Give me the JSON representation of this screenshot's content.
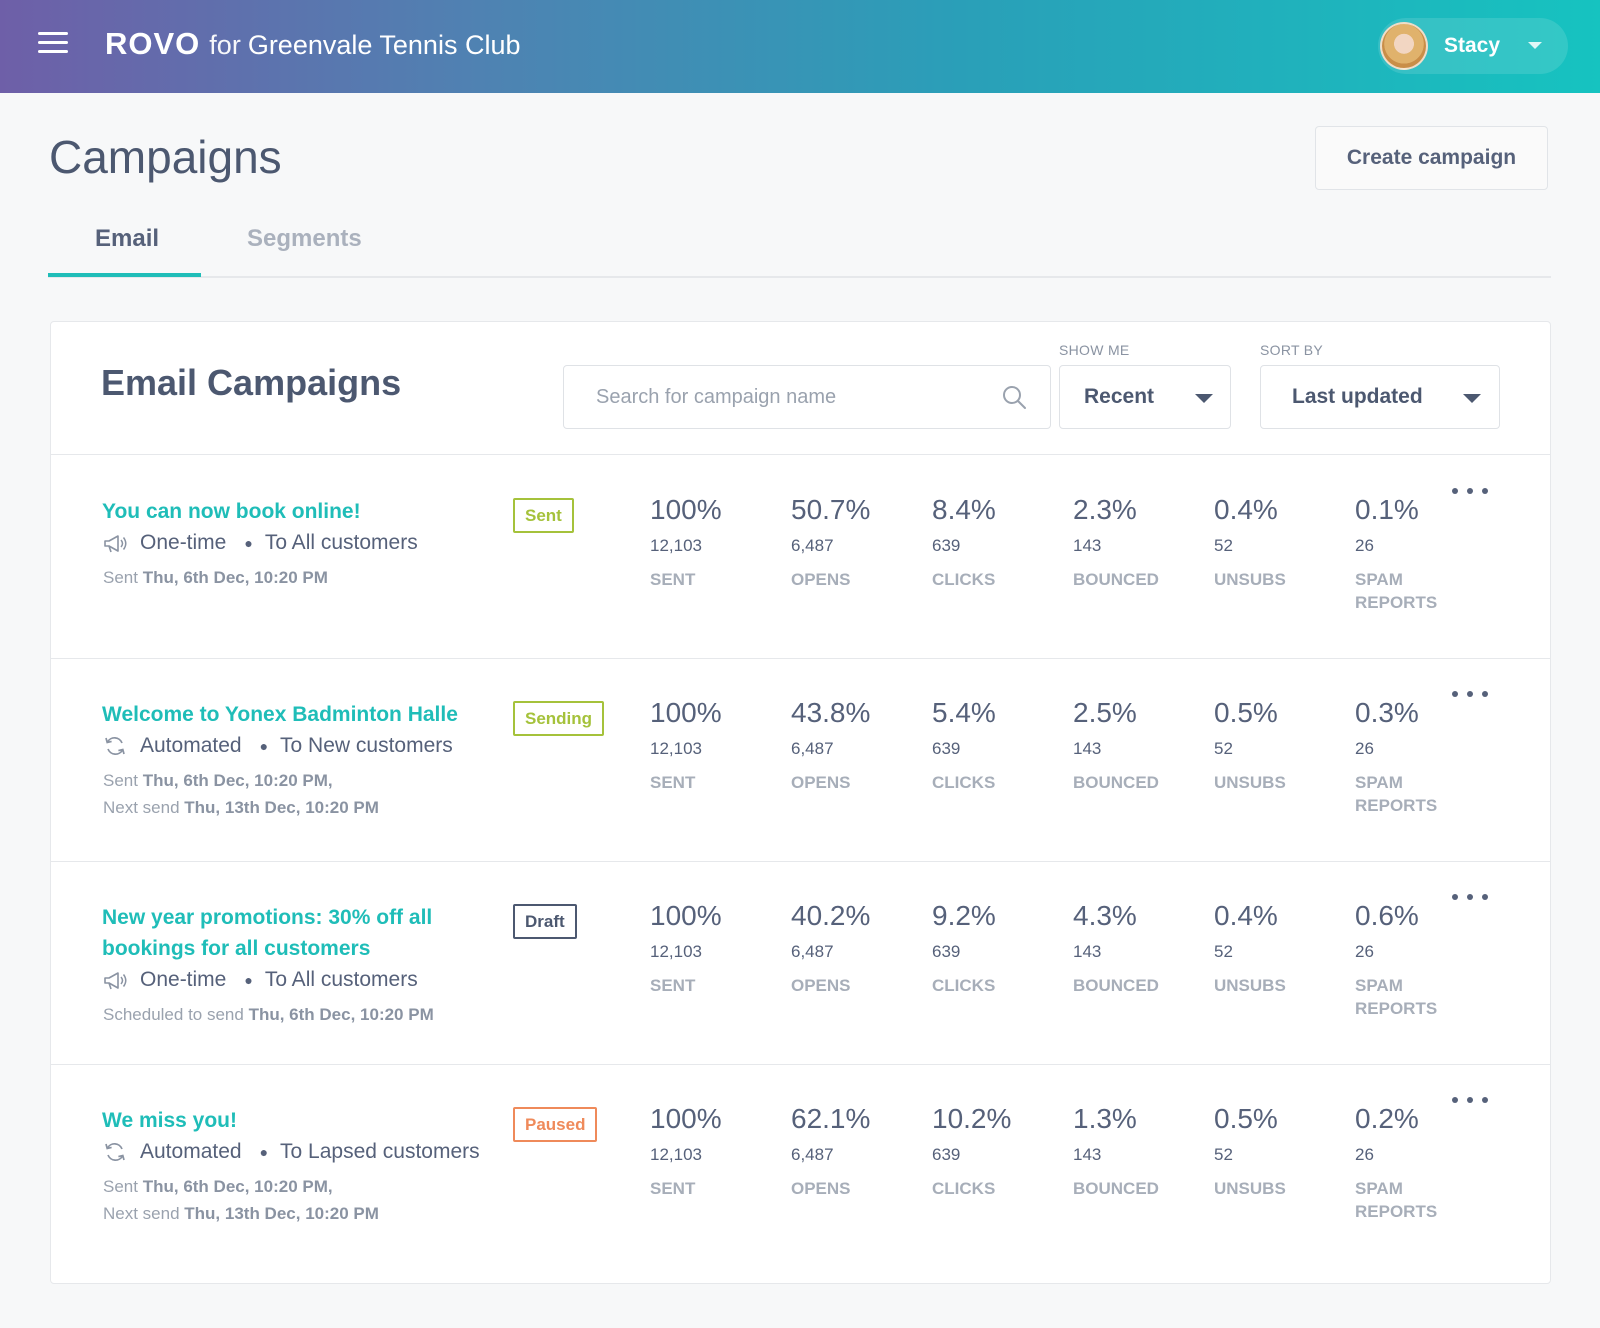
{
  "header": {
    "logo_word": "ROVO",
    "logo_for": "for",
    "club_name": "Greenvale Tennis Club",
    "user_name": "Stacy"
  },
  "page": {
    "title": "Campaigns",
    "create_label": "Create campaign"
  },
  "tabs": [
    {
      "label": "Email",
      "active": true
    },
    {
      "label": "Segments",
      "active": false
    }
  ],
  "card": {
    "title": "Email Campaigns",
    "search_placeholder": "Search for campaign name",
    "show_me_label": "SHOW ME",
    "show_me_value": "Recent",
    "sort_by_label": "SORT BY",
    "sort_by_value": "Last updated"
  },
  "stat_labels": [
    "SENT",
    "OPENS",
    "CLICKS",
    "BOUNCED",
    "UNSUBS",
    "SPAM REPORTS"
  ],
  "campaigns": [
    {
      "name": "You can now book online!",
      "status": "Sent",
      "status_color": "#a5c23b",
      "type": "One-time",
      "type_icon": "megaphone-icon",
      "audience": "To All customers",
      "date_prefix": "Sent",
      "date": "Thu, 6th Dec, 10:20 PM",
      "next_prefix": "",
      "next_date": "",
      "stats": [
        {
          "pct": "100%",
          "num": "12,103"
        },
        {
          "pct": "50.7%",
          "num": "6,487"
        },
        {
          "pct": "8.4%",
          "num": "639"
        },
        {
          "pct": "2.3%",
          "num": "143"
        },
        {
          "pct": "0.4%",
          "num": "52"
        },
        {
          "pct": "0.1%",
          "num": "26"
        }
      ]
    },
    {
      "name": "Welcome to Yonex Badminton Halle",
      "status": "Sending",
      "status_color": "#a5c23b",
      "type": "Automated",
      "type_icon": "refresh-icon",
      "audience": "To New customers",
      "date_prefix": "Sent",
      "date": "Thu, 6th Dec, 10:20 PM,",
      "next_prefix": "Next send",
      "next_date": "Thu, 13th Dec, 10:20 PM",
      "stats": [
        {
          "pct": "100%",
          "num": "12,103"
        },
        {
          "pct": "43.8%",
          "num": "6,487"
        },
        {
          "pct": "5.4%",
          "num": "639"
        },
        {
          "pct": "2.5%",
          "num": "143"
        },
        {
          "pct": "0.5%",
          "num": "52"
        },
        {
          "pct": "0.3%",
          "num": "26"
        }
      ]
    },
    {
      "name": "New year promotions: 30% off all bookings for all customers",
      "status": "Draft",
      "status_color": "#4c5870",
      "type": "One-time",
      "type_icon": "megaphone-icon",
      "audience": "To All customers",
      "date_prefix": "Scheduled to send",
      "date": "Thu, 6th Dec, 10:20 PM",
      "next_prefix": "",
      "next_date": "",
      "stats": [
        {
          "pct": "100%",
          "num": "12,103"
        },
        {
          "pct": "40.2%",
          "num": "6,487"
        },
        {
          "pct": "9.2%",
          "num": "639"
        },
        {
          "pct": "4.3%",
          "num": "143"
        },
        {
          "pct": "0.4%",
          "num": "52"
        },
        {
          "pct": "0.6%",
          "num": "26"
        }
      ]
    },
    {
      "name": "We miss you!",
      "status": "Paused",
      "status_color": "#ef8a5a",
      "type": "Automated",
      "type_icon": "refresh-icon",
      "audience": "To Lapsed customers",
      "date_prefix": "Sent",
      "date": "Thu, 6th Dec, 10:20 PM,",
      "next_prefix": "Next send",
      "next_date": "Thu, 13th Dec, 10:20 PM",
      "stats": [
        {
          "pct": "100%",
          "num": "12,103"
        },
        {
          "pct": "62.1%",
          "num": "6,487"
        },
        {
          "pct": "10.2%",
          "num": "639"
        },
        {
          "pct": "1.3%",
          "num": "143"
        },
        {
          "pct": "0.5%",
          "num": "52"
        },
        {
          "pct": "0.2%",
          "num": "26"
        }
      ]
    }
  ]
}
